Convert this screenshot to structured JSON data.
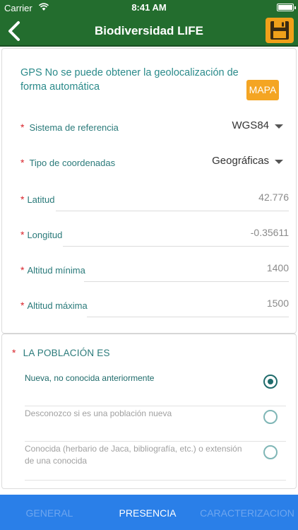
{
  "status_bar": {
    "carrier": "Carrier",
    "time": "8:41 AM"
  },
  "nav": {
    "title": "Biodiversidad LIFE",
    "back_icon": "chevron-left-icon",
    "save_icon": "floppy-disk-icon"
  },
  "gps": {
    "message": "GPS No se puede obtener la geolocalización de forma automática",
    "map_button": "MAPA"
  },
  "fields": {
    "required_mark": "*",
    "reference_system": {
      "label": "Sistema de referencia",
      "value": "WGS84"
    },
    "coordinate_type": {
      "label": "Tipo de coordenadas",
      "value": "Geográficas"
    },
    "latitude": {
      "label": "Latitud",
      "value": "42.776"
    },
    "longitude": {
      "label": "Longitud",
      "value": "-0.35611"
    },
    "min_altitude": {
      "label": "Altitud mínima",
      "value": "1400"
    },
    "max_altitude": {
      "label": "Altitud máxima",
      "value": "1500"
    }
  },
  "population": {
    "title": "LA POBLACIÓN ES",
    "options": [
      {
        "label": "Nueva, no conocida anteriormente",
        "selected": true
      },
      {
        "label": "Desconozco si es una población nueva",
        "selected": false
      },
      {
        "label": "Conocida (herbario de Jaca, bibliografía, etc.) o extensión de una conocida",
        "selected": false
      }
    ]
  },
  "tabs": [
    {
      "label": "GENERAL",
      "active": false
    },
    {
      "label": "PRESENCIA",
      "active": true
    },
    {
      "label": "CARACTERIZACION",
      "active": false
    }
  ],
  "colors": {
    "header": "#236d2e",
    "accent": "#f4a523",
    "tab_bar": "#2a7fe8",
    "teal_text": "#2a7a7a",
    "required": "#d8232a"
  }
}
